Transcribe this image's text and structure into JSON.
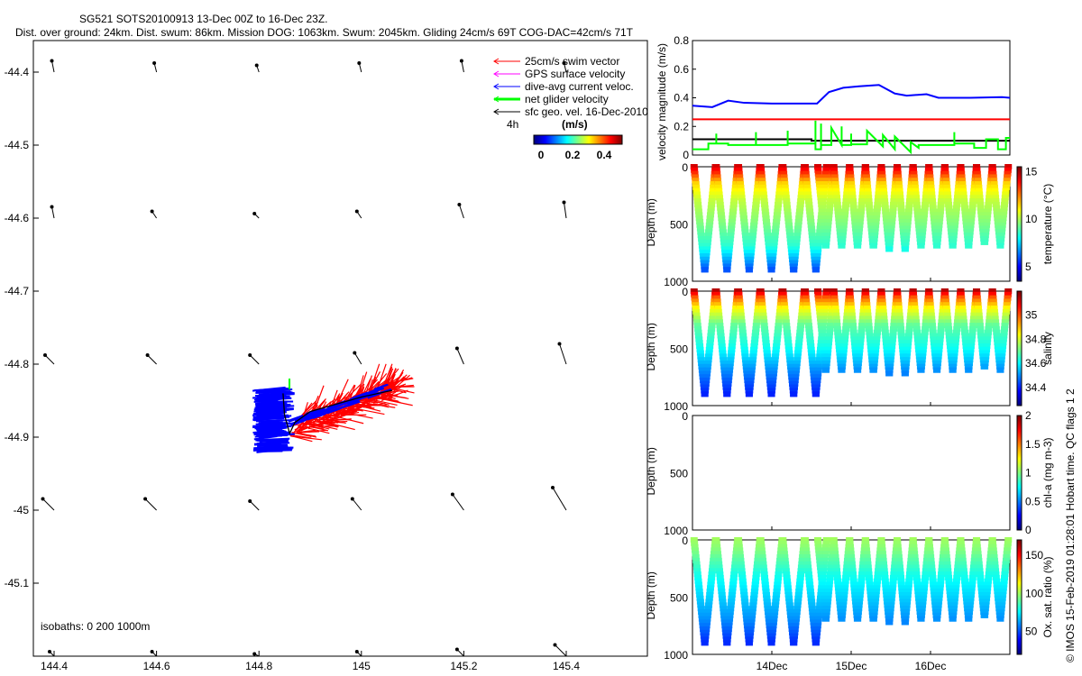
{
  "title_line1": "SG521 SOTS20100913 13-Dec 00Z to 16-Dec 23Z.",
  "title_line2": "Dist. over ground: 24km. Dist. swum: 86km. Mission DOG: 1063km. Swum: 2045km. Gliding 24cm/s 69T COG-DAC=42cm/s 71T",
  "footer": "© IMOS 15-Feb-2019 01:28:01 Hobart time. QC flags 1  2",
  "legend": {
    "items": [
      {
        "label": "25cm/s swim vector",
        "color": "#ff0000"
      },
      {
        "label": "GPS surface velocity",
        "color": "#ff00ff"
      },
      {
        "label": "dive-avg current veloc.",
        "color": "#0000ff"
      },
      {
        "label": "net glider velocity",
        "color": "#00ff00"
      },
      {
        "label": "sfc geo. vel. 16-Dec-2010",
        "color": "#000000"
      }
    ],
    "time_label": "4h",
    "colorbar_label": "(m/s)",
    "colorbar_ticks": [
      "0",
      "0.2",
      "0.4"
    ]
  },
  "chart_data": [
    {
      "type": "map",
      "xticks": [
        "144.4",
        "144.6",
        "144.8",
        "145",
        "145.2",
        "145.4"
      ],
      "yticks": [
        "-44.4",
        "-44.5",
        "-44.6",
        "-44.7",
        "-44.8",
        "-44.9",
        "-45",
        "-45.1"
      ],
      "xlim": [
        144.36,
        145.55
      ],
      "ylim": [
        -45.2,
        -44.357
      ],
      "isobaths_label": "isobaths: 0   200  1000m",
      "sfc_vectors": {
        "lons": [
          144.4,
          144.6,
          144.8,
          145.0,
          145.2,
          145.4
        ],
        "lats": [
          -44.4,
          -44.6,
          -44.8,
          -44.9,
          -45.0,
          -45.2
        ],
        "u": [
          [
            -0.01,
            -0.01,
            -0.01,
            -0.01,
            -0.01,
            -0.01
          ],
          [
            -0.01,
            -0.02,
            -0.02,
            -0.02,
            -0.02,
            -0.01
          ],
          [
            -0.04,
            -0.04,
            -0.04,
            -0.03,
            -0.03,
            -0.03
          ],
          [
            0,
            0,
            0,
            0,
            0,
            0
          ],
          [
            -0.05,
            -0.05,
            -0.04,
            -0.04,
            -0.05,
            -0.06
          ],
          [
            -0.02,
            -0.02,
            -0.02,
            -0.02,
            -0.03,
            -0.05
          ]
        ],
        "v": [
          [
            0.05,
            0.04,
            0.03,
            0.04,
            0.05,
            0.04
          ],
          [
            0.05,
            0.03,
            0.02,
            0.03,
            0.06,
            0.07
          ],
          [
            0.04,
            0.04,
            0.04,
            0.05,
            0.07,
            0.09
          ],
          [
            0,
            0,
            0,
            0,
            0,
            0
          ],
          [
            0.05,
            0.05,
            0.04,
            0.05,
            0.07,
            0.1
          ],
          [
            0.02,
            0.02,
            0.01,
            0.02,
            0.03,
            0.05
          ]
        ]
      },
      "track": {
        "lon": [
          145.06,
          145.0,
          144.95,
          144.9,
          144.87,
          144.86,
          144.85,
          144.847
        ],
        "lat": [
          -44.836,
          -44.845,
          -44.855,
          -44.865,
          -44.88,
          -44.895,
          -44.87,
          -44.84
        ]
      }
    },
    {
      "type": "line",
      "ylabel": "velocity magnitude (m/s)",
      "ylim": [
        0,
        0.8
      ],
      "yticks": [
        "0",
        "0.2",
        "0.4",
        "0.6",
        "0.8"
      ],
      "xlim": [
        13.0,
        17.0
      ],
      "series": [
        {
          "color": "#0000ff",
          "x": [
            13.0,
            13.25,
            13.45,
            13.65,
            14.0,
            14.3,
            14.57,
            14.72,
            14.9,
            15.1,
            15.35,
            15.55,
            15.7,
            15.95,
            16.1,
            16.5,
            16.9,
            17.0
          ],
          "y": [
            0.345,
            0.335,
            0.38,
            0.365,
            0.36,
            0.36,
            0.36,
            0.44,
            0.47,
            0.48,
            0.49,
            0.43,
            0.415,
            0.425,
            0.4,
            0.4,
            0.405,
            0.4
          ]
        },
        {
          "color": "#ff0000",
          "x": [
            13.0,
            17.0
          ],
          "y": [
            0.25,
            0.25
          ]
        },
        {
          "color": "#000000",
          "x": [
            13.0,
            14.5,
            14.5,
            17.0
          ],
          "y": [
            0.11,
            0.11,
            0.1,
            0.1
          ]
        },
        {
          "color": "#00ff00",
          "x": [
            13.0,
            13.2,
            13.2,
            13.3,
            13.3,
            13.3,
            13.45,
            13.45,
            13.8,
            13.8,
            13.8,
            14.2,
            14.2,
            14.2,
            14.55,
            14.55,
            14.55,
            14.62,
            14.62,
            14.62,
            14.75,
            14.75,
            14.88,
            14.88,
            14.88,
            15.0,
            15.0,
            15.0,
            15.2,
            15.2,
            15.4,
            15.4,
            15.55,
            15.55,
            15.75,
            15.75,
            15.85,
            15.85,
            16.3,
            16.3,
            16.3,
            16.55,
            16.55,
            16.7,
            16.7,
            16.85,
            16.85,
            16.95,
            16.95,
            17.0
          ],
          "y": [
            0.04,
            0.04,
            0.08,
            0.08,
            0.15,
            0.08,
            0.08,
            0.07,
            0.07,
            0.16,
            0.07,
            0.07,
            0.17,
            0.08,
            0.08,
            0.24,
            0.04,
            0.04,
            0.22,
            0.07,
            0.07,
            0.19,
            0.07,
            0.2,
            0.07,
            0.07,
            0.15,
            0.075,
            0.075,
            0.17,
            0.06,
            0.14,
            0.04,
            0.13,
            0.02,
            0.09,
            0.05,
            0.07,
            0.07,
            0.16,
            0.08,
            0.08,
            0.05,
            0.05,
            0.11,
            0.11,
            0.04,
            0.04,
            0.12,
            0.12
          ]
        }
      ]
    },
    {
      "type": "scatter",
      "ylabel": "Depth (m)",
      "ylim": [
        1000,
        0
      ],
      "yticks": [
        "0",
        "500",
        "1000"
      ],
      "xticks": [
        "14Dec",
        "15Dec",
        "16Dec"
      ],
      "xtick_values": [
        14,
        15,
        16
      ],
      "xlim": [
        13.0,
        17.0
      ],
      "dives": {
        "start": [
          13.02,
          13.3,
          13.58,
          13.86,
          14.14,
          14.42,
          14.58,
          14.78,
          14.98,
          15.18,
          15.38,
          15.58,
          15.78,
          15.98,
          16.18,
          16.38,
          16.58,
          16.78
        ],
        "duration": [
          0.27,
          0.27,
          0.27,
          0.27,
          0.27,
          0.27,
          0.2,
          0.2,
          0.2,
          0.2,
          0.2,
          0.2,
          0.2,
          0.2,
          0.2,
          0.2,
          0.2,
          0.2
        ],
        "max_depth": [
          900,
          900,
          900,
          900,
          900,
          900,
          700,
          700,
          700,
          710,
          720,
          720,
          700,
          700,
          690,
          690,
          680,
          690
        ]
      },
      "panels": [
        {
          "label": "temperature (°C)",
          "cticks": [
            "5",
            "10",
            "15"
          ],
          "clim": [
            3.5,
            15.5
          ],
          "profile_depth": [
            0,
            60,
            150,
            300,
            500,
            700,
            900
          ],
          "profile_value": [
            14.5,
            13.5,
            11.5,
            10.3,
            9.5,
            8.5,
            6.0
          ]
        },
        {
          "label": "salinity",
          "cticks": [
            "34.4",
            "34.6",
            "34.8",
            "35"
          ],
          "clim": [
            34.25,
            35.2
          ],
          "profile_depth": [
            0,
            60,
            150,
            300,
            500,
            700,
            900
          ],
          "profile_value": [
            35.15,
            35.0,
            34.85,
            34.7,
            34.62,
            34.5,
            34.4
          ]
        },
        {
          "label": "chl-a (mg m-3)",
          "cticks": [
            "0",
            "0.5",
            "1",
            "1.5",
            "2"
          ],
          "clim": [
            0,
            2
          ],
          "profile_depth": [],
          "profile_value": []
        },
        {
          "label": "Ox. sat. ratio (%)",
          "cticks": [
            "50",
            "100",
            "150"
          ],
          "clim": [
            20,
            170
          ],
          "profile_depth": [
            0,
            100,
            300,
            500,
            700,
            900
          ],
          "profile_value": [
            100,
            95,
            80,
            70,
            60,
            45
          ]
        }
      ]
    }
  ]
}
